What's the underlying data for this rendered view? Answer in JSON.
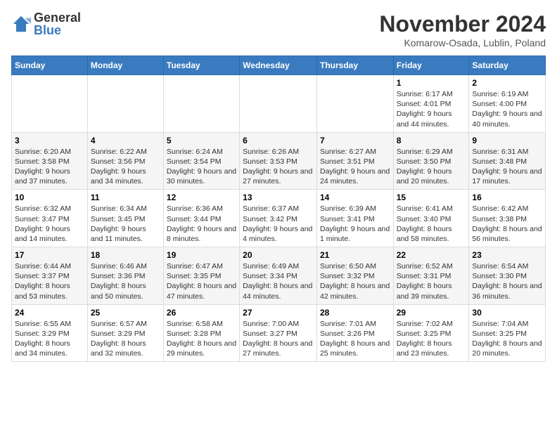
{
  "logo": {
    "general": "General",
    "blue": "Blue"
  },
  "title": "November 2024",
  "location": "Komarow-Osada, Lublin, Poland",
  "weekdays": [
    "Sunday",
    "Monday",
    "Tuesday",
    "Wednesday",
    "Thursday",
    "Friday",
    "Saturday"
  ],
  "weeks": [
    [
      {
        "day": "",
        "info": ""
      },
      {
        "day": "",
        "info": ""
      },
      {
        "day": "",
        "info": ""
      },
      {
        "day": "",
        "info": ""
      },
      {
        "day": "",
        "info": ""
      },
      {
        "day": "1",
        "info": "Sunrise: 6:17 AM\nSunset: 4:01 PM\nDaylight: 9 hours and 44 minutes."
      },
      {
        "day": "2",
        "info": "Sunrise: 6:19 AM\nSunset: 4:00 PM\nDaylight: 9 hours and 40 minutes."
      }
    ],
    [
      {
        "day": "3",
        "info": "Sunrise: 6:20 AM\nSunset: 3:58 PM\nDaylight: 9 hours and 37 minutes."
      },
      {
        "day": "4",
        "info": "Sunrise: 6:22 AM\nSunset: 3:56 PM\nDaylight: 9 hours and 34 minutes."
      },
      {
        "day": "5",
        "info": "Sunrise: 6:24 AM\nSunset: 3:54 PM\nDaylight: 9 hours and 30 minutes."
      },
      {
        "day": "6",
        "info": "Sunrise: 6:26 AM\nSunset: 3:53 PM\nDaylight: 9 hours and 27 minutes."
      },
      {
        "day": "7",
        "info": "Sunrise: 6:27 AM\nSunset: 3:51 PM\nDaylight: 9 hours and 24 minutes."
      },
      {
        "day": "8",
        "info": "Sunrise: 6:29 AM\nSunset: 3:50 PM\nDaylight: 9 hours and 20 minutes."
      },
      {
        "day": "9",
        "info": "Sunrise: 6:31 AM\nSunset: 3:48 PM\nDaylight: 9 hours and 17 minutes."
      }
    ],
    [
      {
        "day": "10",
        "info": "Sunrise: 6:32 AM\nSunset: 3:47 PM\nDaylight: 9 hours and 14 minutes."
      },
      {
        "day": "11",
        "info": "Sunrise: 6:34 AM\nSunset: 3:45 PM\nDaylight: 9 hours and 11 minutes."
      },
      {
        "day": "12",
        "info": "Sunrise: 6:36 AM\nSunset: 3:44 PM\nDaylight: 9 hours and 8 minutes."
      },
      {
        "day": "13",
        "info": "Sunrise: 6:37 AM\nSunset: 3:42 PM\nDaylight: 9 hours and 4 minutes."
      },
      {
        "day": "14",
        "info": "Sunrise: 6:39 AM\nSunset: 3:41 PM\nDaylight: 9 hours and 1 minute."
      },
      {
        "day": "15",
        "info": "Sunrise: 6:41 AM\nSunset: 3:40 PM\nDaylight: 8 hours and 58 minutes."
      },
      {
        "day": "16",
        "info": "Sunrise: 6:42 AM\nSunset: 3:38 PM\nDaylight: 8 hours and 56 minutes."
      }
    ],
    [
      {
        "day": "17",
        "info": "Sunrise: 6:44 AM\nSunset: 3:37 PM\nDaylight: 8 hours and 53 minutes."
      },
      {
        "day": "18",
        "info": "Sunrise: 6:46 AM\nSunset: 3:36 PM\nDaylight: 8 hours and 50 minutes."
      },
      {
        "day": "19",
        "info": "Sunrise: 6:47 AM\nSunset: 3:35 PM\nDaylight: 8 hours and 47 minutes."
      },
      {
        "day": "20",
        "info": "Sunrise: 6:49 AM\nSunset: 3:34 PM\nDaylight: 8 hours and 44 minutes."
      },
      {
        "day": "21",
        "info": "Sunrise: 6:50 AM\nSunset: 3:32 PM\nDaylight: 8 hours and 42 minutes."
      },
      {
        "day": "22",
        "info": "Sunrise: 6:52 AM\nSunset: 3:31 PM\nDaylight: 8 hours and 39 minutes."
      },
      {
        "day": "23",
        "info": "Sunrise: 6:54 AM\nSunset: 3:30 PM\nDaylight: 8 hours and 36 minutes."
      }
    ],
    [
      {
        "day": "24",
        "info": "Sunrise: 6:55 AM\nSunset: 3:29 PM\nDaylight: 8 hours and 34 minutes."
      },
      {
        "day": "25",
        "info": "Sunrise: 6:57 AM\nSunset: 3:29 PM\nDaylight: 8 hours and 32 minutes."
      },
      {
        "day": "26",
        "info": "Sunrise: 6:58 AM\nSunset: 3:28 PM\nDaylight: 8 hours and 29 minutes."
      },
      {
        "day": "27",
        "info": "Sunrise: 7:00 AM\nSunset: 3:27 PM\nDaylight: 8 hours and 27 minutes."
      },
      {
        "day": "28",
        "info": "Sunrise: 7:01 AM\nSunset: 3:26 PM\nDaylight: 8 hours and 25 minutes."
      },
      {
        "day": "29",
        "info": "Sunrise: 7:02 AM\nSunset: 3:25 PM\nDaylight: 8 hours and 23 minutes."
      },
      {
        "day": "30",
        "info": "Sunrise: 7:04 AM\nSunset: 3:25 PM\nDaylight: 8 hours and 20 minutes."
      }
    ]
  ]
}
